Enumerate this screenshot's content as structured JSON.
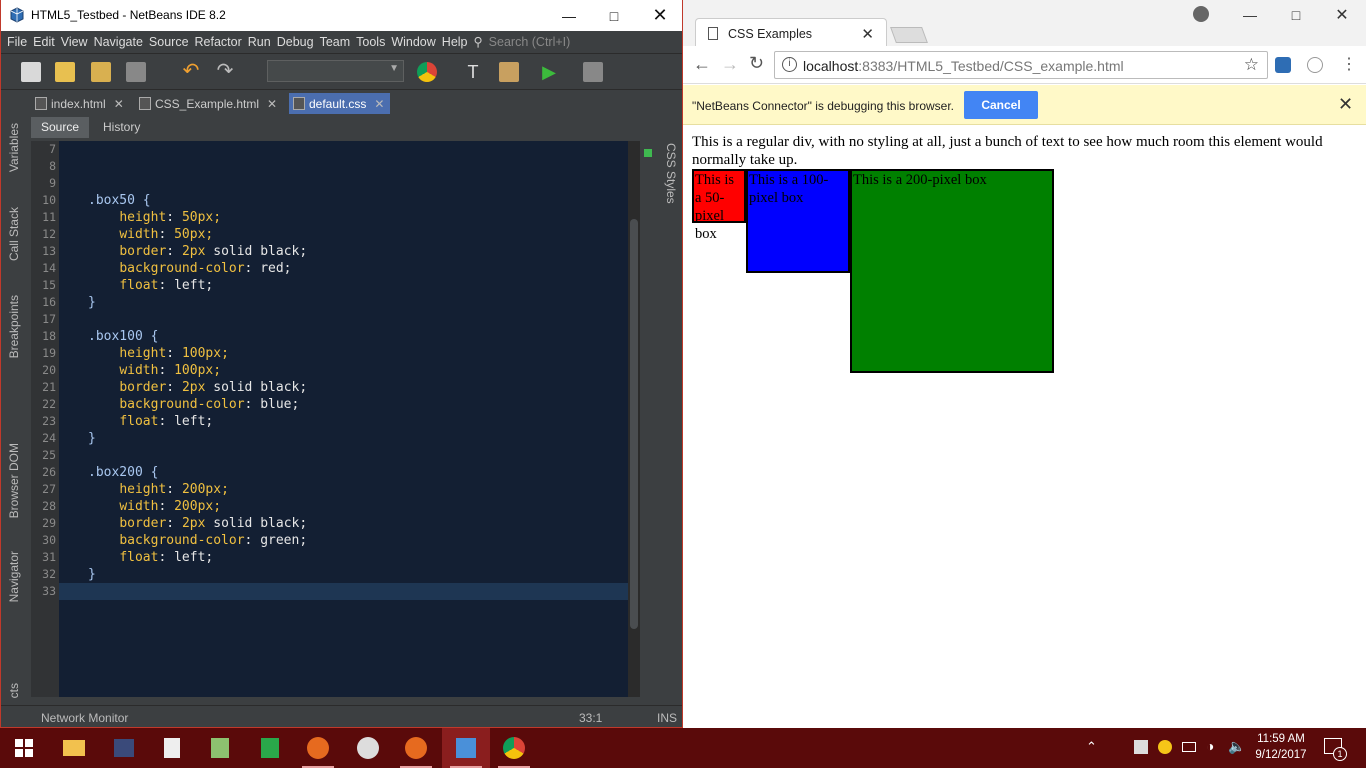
{
  "netbeans": {
    "title": "HTML5_Testbed - NetBeans IDE 8.2",
    "menu": [
      "File",
      "Edit",
      "View",
      "Navigate",
      "Source",
      "Refactor",
      "Run",
      "Debug",
      "Team",
      "Tools",
      "Window",
      "Help"
    ],
    "search_placeholder": "Search (Ctrl+I)",
    "editor_tabs": [
      {
        "label": "index.html",
        "active": false
      },
      {
        "label": "CSS_Example.html",
        "active": false
      },
      {
        "label": "default.css",
        "active": true
      }
    ],
    "source_tab": "Source",
    "history_tab": "History",
    "left_panels": [
      "Variables",
      "Call Stack",
      "Breakpoints",
      "Browser DOM",
      "Navigator",
      "cts"
    ],
    "right_panel": "CSS Styles",
    "line_numbers": [
      "7",
      "8",
      "9",
      "10",
      "11",
      "12",
      "13",
      "14",
      "15",
      "16",
      "17",
      "18",
      "19",
      "20",
      "21",
      "22",
      "23",
      "24",
      "25",
      "26",
      "27",
      "28",
      "29",
      "30",
      "31",
      "32",
      "33"
    ],
    "code": [
      {
        "sel": ""
      },
      {
        "sel": ""
      },
      {
        "sel": ""
      },
      {
        "sel": ".box50 {"
      },
      {
        "prop": "height",
        "val": "50px;"
      },
      {
        "prop": "width",
        "val": "50px;"
      },
      {
        "prop": "border",
        "val": "2px",
        "rest": " solid black;"
      },
      {
        "prop": "background-color",
        "rest": " red;"
      },
      {
        "prop": "float",
        "rest": " left;"
      },
      {
        "sel": "}"
      },
      {
        "sel": ""
      },
      {
        "sel": ".box100 {"
      },
      {
        "prop": "height",
        "val": "100px;"
      },
      {
        "prop": "width",
        "val": "100px;"
      },
      {
        "prop": "border",
        "val": "2px",
        "rest": " solid black;"
      },
      {
        "prop": "background-color",
        "rest": " blue;"
      },
      {
        "prop": "float",
        "rest": " left;"
      },
      {
        "sel": "}"
      },
      {
        "sel": ""
      },
      {
        "sel": ".box200 {"
      },
      {
        "prop": "height",
        "val": "200px;"
      },
      {
        "prop": "width",
        "val": "200px;"
      },
      {
        "prop": "border",
        "val": "2px",
        "rest": " solid black;"
      },
      {
        "prop": "background-color",
        "rest": " green;"
      },
      {
        "prop": "float",
        "rest": " left;"
      },
      {
        "sel": "}"
      },
      {
        "sel": ""
      }
    ],
    "status": {
      "left": "Network Monitor",
      "pos": "33:1",
      "mode": "INS"
    }
  },
  "chrome": {
    "tab_title": "CSS Examples",
    "url_host": "localhost",
    "url_rest": ":8383/HTML5_Testbed/CSS_example.html",
    "infobar_message": "\"NetBeans Connector\" is debugging this browser.",
    "cancel_label": "Cancel",
    "page": {
      "paragraph": "This is a regular div, with no styling at all, just a bunch of text to see how much room this element would normally take up.",
      "box50": "This is a 50-pixel box",
      "box100": "This is a 100-pixel box",
      "box200": "This is a 200-pixel box",
      "colors": {
        "box50": "#ff0000",
        "box100": "#0000ff",
        "box200": "#008000"
      }
    }
  },
  "taskbar": {
    "time": "11:59 AM",
    "date": "9/12/2017",
    "notification_count": "1"
  }
}
